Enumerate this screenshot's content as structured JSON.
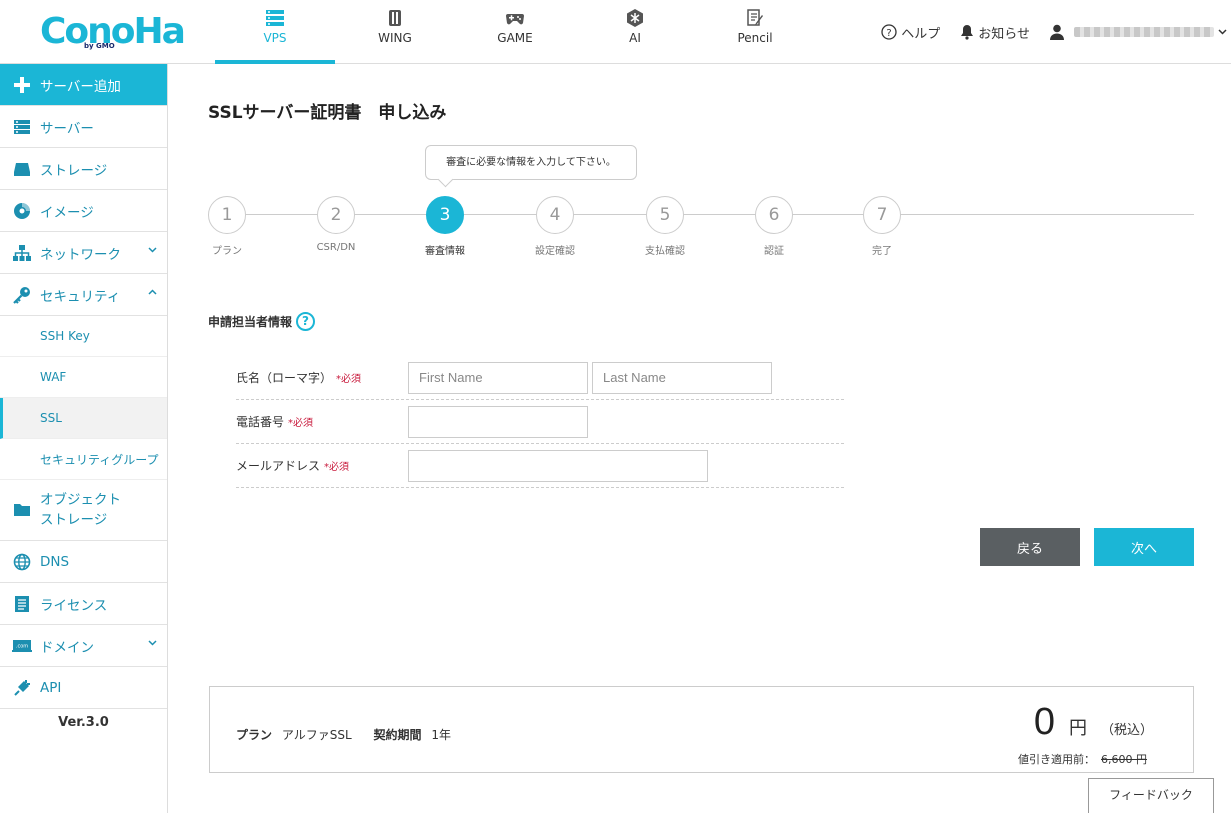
{
  "header": {
    "logo_text": "ConoHa",
    "logo_sub": "by GMO",
    "services": [
      {
        "label": "VPS",
        "icon": "server-icon",
        "active": true
      },
      {
        "label": "WING",
        "icon": "wing-icon",
        "active": false
      },
      {
        "label": "GAME",
        "icon": "gamepad-icon",
        "active": false
      },
      {
        "label": "AI",
        "icon": "ai-icon",
        "active": false
      },
      {
        "label": "Pencil",
        "icon": "pencil-icon",
        "active": false
      }
    ],
    "help_label": "ヘルプ",
    "notice_label": "お知らせ"
  },
  "sidebar": {
    "add_server": "サーバー追加",
    "items": [
      {
        "label": "サーバー",
        "icon": "server-icon"
      },
      {
        "label": "ストレージ",
        "icon": "storage-icon"
      },
      {
        "label": "イメージ",
        "icon": "image-disc-icon"
      },
      {
        "label": "ネットワーク",
        "icon": "network-icon"
      },
      {
        "label": "セキュリティ",
        "icon": "key-icon"
      }
    ],
    "security_sub": [
      "SSH Key",
      "WAF",
      "SSL",
      "セキュリティグループ"
    ],
    "object_storage_line1": "オブジェクト",
    "object_storage_line2": "ストレージ",
    "lower_items": [
      {
        "label": "DNS",
        "icon": "globe-icon"
      },
      {
        "label": "ライセンス",
        "icon": "license-icon"
      },
      {
        "label": "ドメイン",
        "icon": "domain-icon"
      },
      {
        "label": "API",
        "icon": "api-icon"
      }
    ],
    "version": "Ver.3.0"
  },
  "main": {
    "title": "SSLサーバー証明書　申し込み",
    "tooltip": "審査に必要な情報を入力して下さい。",
    "steps": [
      {
        "num": "1",
        "label": "プラン"
      },
      {
        "num": "2",
        "label": "CSR/DN"
      },
      {
        "num": "3",
        "label": "審査情報"
      },
      {
        "num": "4",
        "label": "設定確認"
      },
      {
        "num": "5",
        "label": "支払確認"
      },
      {
        "num": "6",
        "label": "認証"
      },
      {
        "num": "7",
        "label": "完了"
      }
    ],
    "active_step": 3,
    "section_title": "申請担当者情報",
    "help_mark": "?",
    "form": {
      "name_label": "氏名（ローマ字）",
      "phone_label": "電話番号",
      "email_label": "メールアドレス",
      "required": "*必須",
      "first_name_placeholder": "First Name",
      "last_name_placeholder": "Last Name",
      "first_name_value": "",
      "last_name_value": "",
      "phone_value": "",
      "email_value": ""
    },
    "back_button": "戻る",
    "next_button": "次へ"
  },
  "summary": {
    "plan_label": "プラン",
    "plan_value": "アルファSSL",
    "term_label": "契約期間",
    "term_value": "1年",
    "price": "0",
    "currency": "円",
    "tax_note": "（税込）",
    "pre_discount_label": "値引き適用前：",
    "pre_discount_value": "6,600 円"
  },
  "feedback": "フィードバック",
  "colors": {
    "accent": "#1bb6d6",
    "back_button": "#5a5f62",
    "required": "#c81a3c"
  }
}
